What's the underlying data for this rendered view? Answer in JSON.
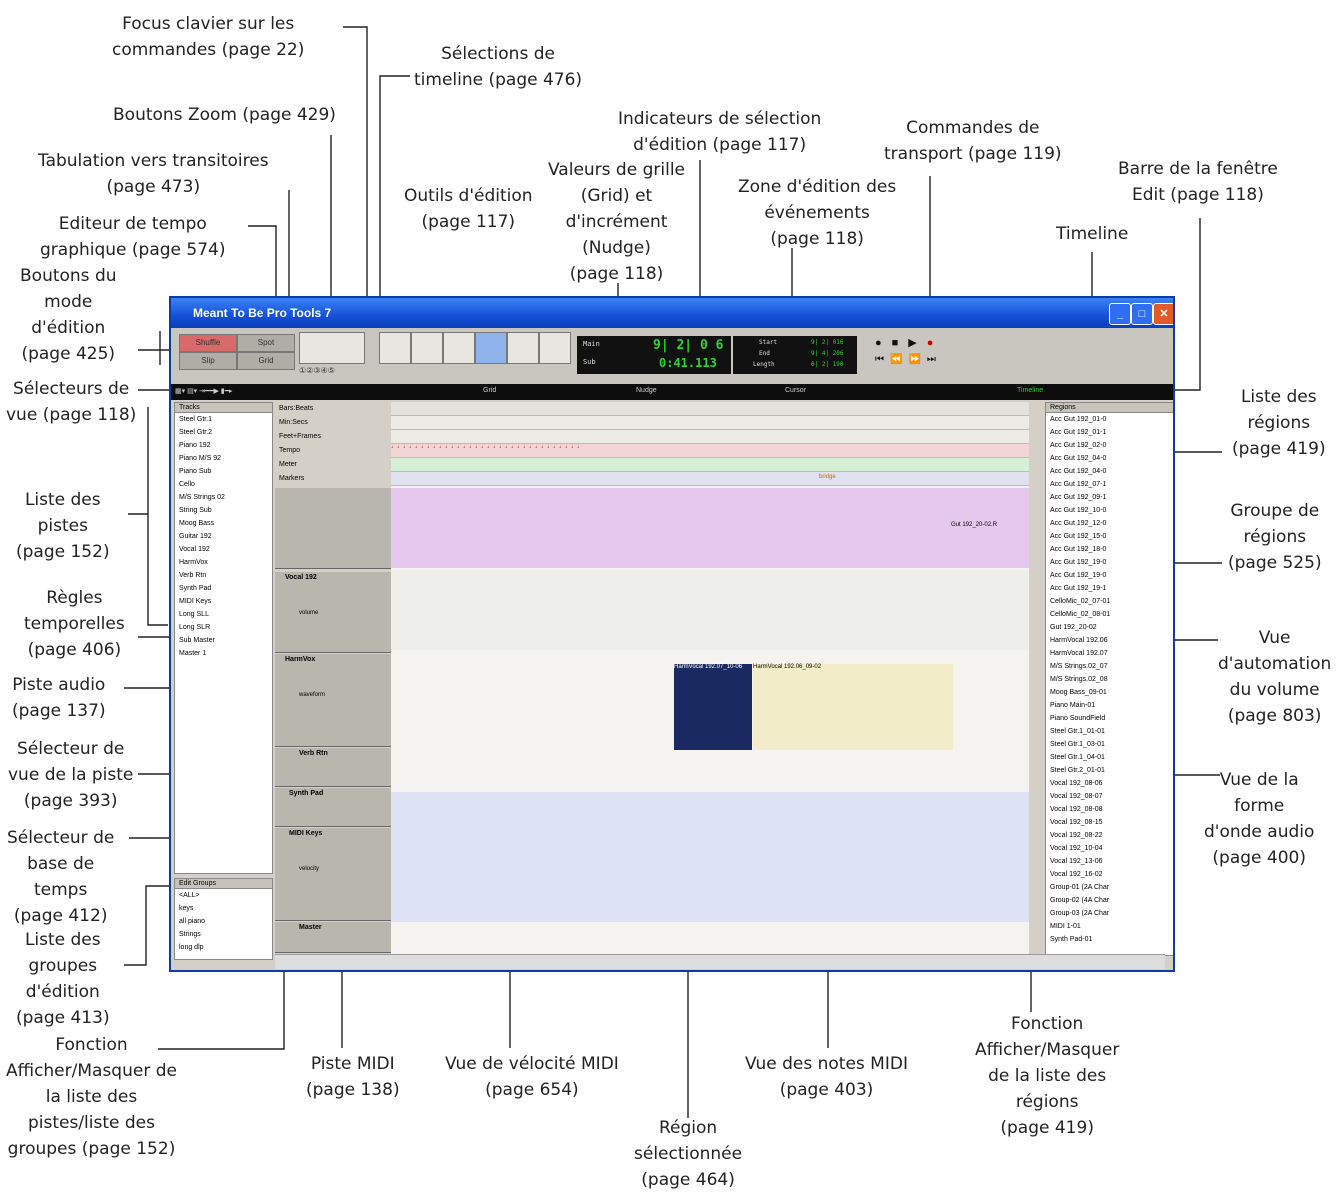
{
  "callouts": {
    "focus": "Focus clavier sur les\ncommandes (page 22)",
    "zoom": "Boutons Zoom (page 429)",
    "tab_transients": "Tabulation vers transitoires\n(page 473)",
    "tempo_editor": "Editeur de tempo\ngraphique (page 574)",
    "edit_modes": "Boutons du\nmode\nd'édition\n(page 425)",
    "view_selectors": "Sélecteurs de\nvue (page 118)",
    "track_list": "Liste des\npistes\n(page 152)",
    "rulers": "Règles\ntemporelles\n(page 406)",
    "audio_track": "Piste audio\n(page 137)",
    "track_view_selector": "Sélecteur de\nvue de la piste\n(page 393)",
    "timebase_selector": "Sélecteur de\nbase de\ntemps\n(page 412)",
    "edit_groups": "Liste des\ngroupes\nd'édition\n(page 413)",
    "show_hide_tracks": "Fonction\nAfficher/Masquer de\nla liste des\npistes/liste des\ngroupes (page 152)",
    "timeline_sel": "Sélections de\ntimeline (page 476)",
    "edit_tools": "Outils d'édition\n(page 117)",
    "grid_nudge": "Valeurs de grille\n(Grid) et\nd'incrément\n(Nudge)\n(page 118)",
    "edit_sel_ind": "Indicateurs de sélection\nd'édition (page 117)",
    "event_edit": "Zone d'édition des\névénements\n(page 118)",
    "transport": "Commandes de\ntransport (page 119)",
    "edit_bar": "Barre de la fenêtre\nEdit (page 118)",
    "timeline": "Timeline",
    "region_list": "Liste des\nrégions\n(page 419)",
    "region_group": "Groupe de\nrégions\n(page 525)",
    "vol_auto": "Vue\nd'automation\ndu volume\n(page 803)",
    "waveform": "Vue de la\nforme\nd'onde audio\n(page 400)",
    "midi_track": "Piste MIDI\n(page 138)",
    "velocity": "Vue de vélocité MIDI\n(page 654)",
    "selected_region": "Région\nsélectionnée\n(page 464)",
    "midi_notes": "Vue des notes MIDI\n(page 403)",
    "show_hide_regions": "Fonction\nAfficher/Masquer\nde la liste des\nrégions\n(page 419)"
  },
  "window": {
    "title": "Meant To Be Pro Tools 7",
    "modes": [
      "Shuffle",
      "Spot",
      "Slip",
      "Grid"
    ],
    "counter_main": "9| 2| 0 6",
    "counter_sub": "0:41.113",
    "main_label": "Main",
    "sub_label": "Sub",
    "start_label": "Start",
    "end_label": "End",
    "length_label": "Length",
    "start_val": "9| 2| 016",
    "end_val": "9| 4| 206",
    "length_val": "0| 2| 190",
    "grid_label": "Grid",
    "nudge_label": "Nudge",
    "cursor_label": "Cursor",
    "timeline_label": "Timeline",
    "tracks_header": "Tracks",
    "groups_header": "Edit Groups",
    "regions_header": "Regions",
    "track_list": [
      "Steel Gtr.1",
      "Steel Gtr.2",
      "Piano 192",
      "Piano M/S 92",
      "Piano Sub",
      "Cello",
      "M/S Strings 02",
      "String Sub",
      "Moog Bass",
      "Guitar 192",
      "Vocal 192",
      "HarmVox",
      "Verb Rtn",
      "Synth Pad",
      "MIDI Keys",
      "Long SLL",
      "Long SLR",
      "Sub Master",
      "Master 1"
    ],
    "group_list": [
      "<ALL>",
      "keys",
      "all piano",
      "Strings",
      "long dlp"
    ],
    "region_list": [
      "Acc Gut 192_01-0",
      "Acc Gut 192_01-1",
      "Acc Gut 192_02-0",
      "Acc Gut 192_04-0",
      "Acc Gut 192_04-0",
      "Acc Gut 192_07-1",
      "Acc Gut 192_09-1",
      "Acc Gut 192_10-0",
      "Acc Gut 192_12-0",
      "Acc Gut 192_15-0",
      "Acc Gut 192_18-0",
      "Acc Gut 192_19-0",
      "Acc Gut 192_19-0",
      "Acc Gut 192_19-1",
      "CelloMic_02_07-01",
      "CelloMic_02_08-01",
      "Gut 192_20-02",
      "HarmVocal 192.06",
      "HarmVocal 192.07",
      "M/S Strings.02_07",
      "M/S Strings.02_08",
      "Moog Bass_09-01",
      "Piano Main-01",
      "Piano SoundField",
      "Steel Gtr.1_01-01",
      "Steel Gtr.1_03-01",
      "Steel Gtr.1_04-01",
      "Steel Gtr.2_01-01",
      "Vocal 192_08-06",
      "Vocal 192_08-07",
      "Vocal 192_08-08",
      "Vocal 192_08-15",
      "Vocal 192_08-22",
      "Vocal 192_10-04",
      "Vocal 192_13-06",
      "Vocal 192_16-02",
      "Group-01 (2A Char",
      "Group-02 (4A Char",
      "Group-03 (2A Char",
      "MIDI 1-01",
      "Synth Pad-01"
    ],
    "rulers": [
      "Bars:Beats",
      "Min:Secs",
      "Feet+Frames",
      "Tempo",
      "Meter",
      "Markers"
    ],
    "track_names": [
      "Vocal 192",
      "HarmVox",
      "Verb Rtn",
      "Synth Pad",
      "MIDI Keys",
      "Master"
    ],
    "view_names": [
      "waveform",
      "volume",
      "waveform",
      "velocity"
    ],
    "region_harm1": "HarmVocal 192.07_10-06",
    "region_harm2": "HarmVocal 192.06_09-02",
    "region_gut": "Gut 192_20-02.R",
    "marker": "bridge"
  }
}
